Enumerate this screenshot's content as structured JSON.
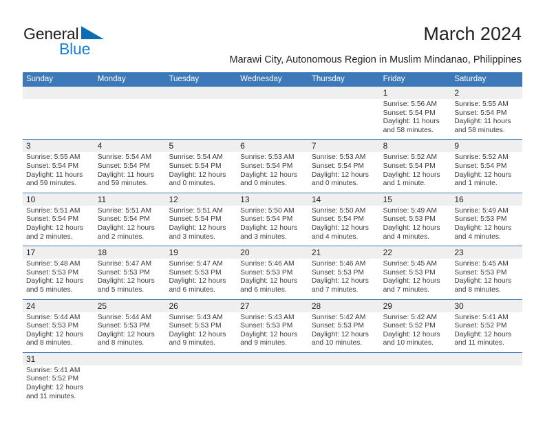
{
  "brand": {
    "name_part1": "General",
    "name_part2": "Blue",
    "flag_icon": "blue-flag-icon",
    "accent_color": "#1b7fd4"
  },
  "header": {
    "title": "March 2024",
    "subtitle": "Marawi City, Autonomous Region in Muslim Mindanao, Philippines"
  },
  "theme": {
    "header_blue": "#3d78b9",
    "row_strip_gray": "#efefef",
    "text_color": "#231f20"
  },
  "weekdays": [
    "Sunday",
    "Monday",
    "Tuesday",
    "Wednesday",
    "Thursday",
    "Friday",
    "Saturday"
  ],
  "weeks": [
    {
      "days": [
        {
          "date": "",
          "lines": []
        },
        {
          "date": "",
          "lines": []
        },
        {
          "date": "",
          "lines": []
        },
        {
          "date": "",
          "lines": []
        },
        {
          "date": "",
          "lines": []
        },
        {
          "date": "1",
          "lines": [
            "Sunrise: 5:56 AM",
            "Sunset: 5:54 PM",
            "Daylight: 11 hours",
            "and 58 minutes."
          ]
        },
        {
          "date": "2",
          "lines": [
            "Sunrise: 5:55 AM",
            "Sunset: 5:54 PM",
            "Daylight: 11 hours",
            "and 58 minutes."
          ]
        }
      ]
    },
    {
      "days": [
        {
          "date": "3",
          "lines": [
            "Sunrise: 5:55 AM",
            "Sunset: 5:54 PM",
            "Daylight: 11 hours",
            "and 59 minutes."
          ]
        },
        {
          "date": "4",
          "lines": [
            "Sunrise: 5:54 AM",
            "Sunset: 5:54 PM",
            "Daylight: 11 hours",
            "and 59 minutes."
          ]
        },
        {
          "date": "5",
          "lines": [
            "Sunrise: 5:54 AM",
            "Sunset: 5:54 PM",
            "Daylight: 12 hours",
            "and 0 minutes."
          ]
        },
        {
          "date": "6",
          "lines": [
            "Sunrise: 5:53 AM",
            "Sunset: 5:54 PM",
            "Daylight: 12 hours",
            "and 0 minutes."
          ]
        },
        {
          "date": "7",
          "lines": [
            "Sunrise: 5:53 AM",
            "Sunset: 5:54 PM",
            "Daylight: 12 hours",
            "and 0 minutes."
          ]
        },
        {
          "date": "8",
          "lines": [
            "Sunrise: 5:52 AM",
            "Sunset: 5:54 PM",
            "Daylight: 12 hours",
            "and 1 minute."
          ]
        },
        {
          "date": "9",
          "lines": [
            "Sunrise: 5:52 AM",
            "Sunset: 5:54 PM",
            "Daylight: 12 hours",
            "and 1 minute."
          ]
        }
      ]
    },
    {
      "days": [
        {
          "date": "10",
          "lines": [
            "Sunrise: 5:51 AM",
            "Sunset: 5:54 PM",
            "Daylight: 12 hours",
            "and 2 minutes."
          ]
        },
        {
          "date": "11",
          "lines": [
            "Sunrise: 5:51 AM",
            "Sunset: 5:54 PM",
            "Daylight: 12 hours",
            "and 2 minutes."
          ]
        },
        {
          "date": "12",
          "lines": [
            "Sunrise: 5:51 AM",
            "Sunset: 5:54 PM",
            "Daylight: 12 hours",
            "and 3 minutes."
          ]
        },
        {
          "date": "13",
          "lines": [
            "Sunrise: 5:50 AM",
            "Sunset: 5:54 PM",
            "Daylight: 12 hours",
            "and 3 minutes."
          ]
        },
        {
          "date": "14",
          "lines": [
            "Sunrise: 5:50 AM",
            "Sunset: 5:54 PM",
            "Daylight: 12 hours",
            "and 4 minutes."
          ]
        },
        {
          "date": "15",
          "lines": [
            "Sunrise: 5:49 AM",
            "Sunset: 5:53 PM",
            "Daylight: 12 hours",
            "and 4 minutes."
          ]
        },
        {
          "date": "16",
          "lines": [
            "Sunrise: 5:49 AM",
            "Sunset: 5:53 PM",
            "Daylight: 12 hours",
            "and 4 minutes."
          ]
        }
      ]
    },
    {
      "days": [
        {
          "date": "17",
          "lines": [
            "Sunrise: 5:48 AM",
            "Sunset: 5:53 PM",
            "Daylight: 12 hours",
            "and 5 minutes."
          ]
        },
        {
          "date": "18",
          "lines": [
            "Sunrise: 5:47 AM",
            "Sunset: 5:53 PM",
            "Daylight: 12 hours",
            "and 5 minutes."
          ]
        },
        {
          "date": "19",
          "lines": [
            "Sunrise: 5:47 AM",
            "Sunset: 5:53 PM",
            "Daylight: 12 hours",
            "and 6 minutes."
          ]
        },
        {
          "date": "20",
          "lines": [
            "Sunrise: 5:46 AM",
            "Sunset: 5:53 PM",
            "Daylight: 12 hours",
            "and 6 minutes."
          ]
        },
        {
          "date": "21",
          "lines": [
            "Sunrise: 5:46 AM",
            "Sunset: 5:53 PM",
            "Daylight: 12 hours",
            "and 7 minutes."
          ]
        },
        {
          "date": "22",
          "lines": [
            "Sunrise: 5:45 AM",
            "Sunset: 5:53 PM",
            "Daylight: 12 hours",
            "and 7 minutes."
          ]
        },
        {
          "date": "23",
          "lines": [
            "Sunrise: 5:45 AM",
            "Sunset: 5:53 PM",
            "Daylight: 12 hours",
            "and 8 minutes."
          ]
        }
      ]
    },
    {
      "days": [
        {
          "date": "24",
          "lines": [
            "Sunrise: 5:44 AM",
            "Sunset: 5:53 PM",
            "Daylight: 12 hours",
            "and 8 minutes."
          ]
        },
        {
          "date": "25",
          "lines": [
            "Sunrise: 5:44 AM",
            "Sunset: 5:53 PM",
            "Daylight: 12 hours",
            "and 8 minutes."
          ]
        },
        {
          "date": "26",
          "lines": [
            "Sunrise: 5:43 AM",
            "Sunset: 5:53 PM",
            "Daylight: 12 hours",
            "and 9 minutes."
          ]
        },
        {
          "date": "27",
          "lines": [
            "Sunrise: 5:43 AM",
            "Sunset: 5:53 PM",
            "Daylight: 12 hours",
            "and 9 minutes."
          ]
        },
        {
          "date": "28",
          "lines": [
            "Sunrise: 5:42 AM",
            "Sunset: 5:53 PM",
            "Daylight: 12 hours",
            "and 10 minutes."
          ]
        },
        {
          "date": "29",
          "lines": [
            "Sunrise: 5:42 AM",
            "Sunset: 5:52 PM",
            "Daylight: 12 hours",
            "and 10 minutes."
          ]
        },
        {
          "date": "30",
          "lines": [
            "Sunrise: 5:41 AM",
            "Sunset: 5:52 PM",
            "Daylight: 12 hours",
            "and 11 minutes."
          ]
        }
      ]
    },
    {
      "days": [
        {
          "date": "31",
          "lines": [
            "Sunrise: 5:41 AM",
            "Sunset: 5:52 PM",
            "Daylight: 12 hours",
            "and 11 minutes."
          ]
        },
        {
          "date": "",
          "lines": []
        },
        {
          "date": "",
          "lines": []
        },
        {
          "date": "",
          "lines": []
        },
        {
          "date": "",
          "lines": []
        },
        {
          "date": "",
          "lines": []
        },
        {
          "date": "",
          "lines": []
        }
      ]
    }
  ]
}
